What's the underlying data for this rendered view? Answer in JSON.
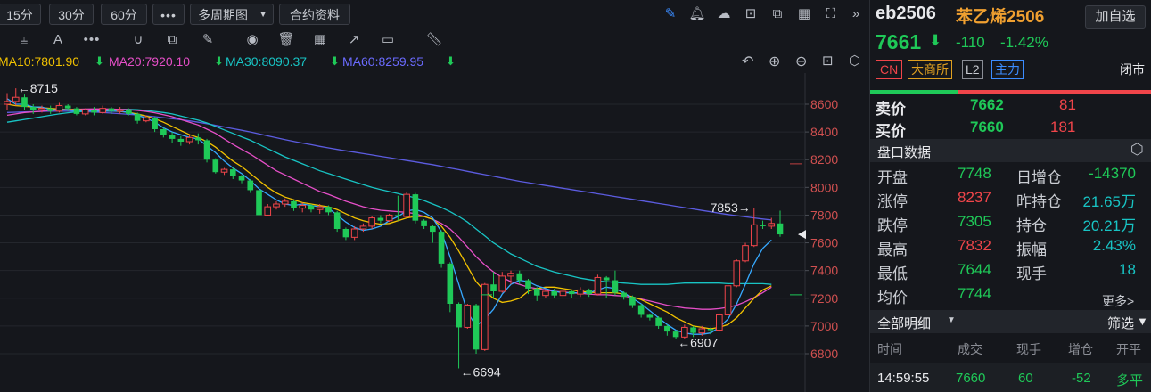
{
  "toolbar": {
    "periods": [
      "15分",
      "30分",
      "60分"
    ],
    "more": "•••",
    "multi_period": "多周期图",
    "contract_info": "合约资料"
  },
  "ma_legend": {
    "ma10": "MA10:7801.90",
    "ma20": "MA20:7920.10",
    "ma30": "MA30:8090.37",
    "ma60": "MA60:8259.95"
  },
  "colors": {
    "ma5": "#36a9ff",
    "ma10": "#f2c200",
    "ma20": "#e64fc8",
    "ma30": "#18c4c4",
    "ma60": "#5c5ce0",
    "up": "#f0454a",
    "down": "#1fc958"
  },
  "chart_data": {
    "type": "candlestick",
    "ylim": [
      6700,
      8750
    ],
    "yticks": [
      "8600",
      "8400",
      "8200",
      "8000",
      "7800",
      "7600",
      "7400",
      "7200",
      "7000",
      "6800"
    ],
    "ytick_values": [
      8600,
      8400,
      8200,
      8000,
      7800,
      7600,
      7400,
      7200,
      7000,
      6800
    ],
    "annotations": {
      "high": "←8715",
      "low": "←6694",
      "local_low": "←6907",
      "local_high": "7853→"
    },
    "annotation_values": {
      "high": 8715,
      "low": 6694,
      "local_low": 6907,
      "local_high": 7853
    },
    "candles": [
      [
        8600,
        8620,
        8560,
        8680
      ],
      [
        8620,
        8650,
        8590,
        8715
      ],
      [
        8650,
        8580,
        8560,
        8670
      ],
      [
        8580,
        8560,
        8530,
        8600
      ],
      [
        8560,
        8570,
        8540,
        8590
      ],
      [
        8570,
        8550,
        8530,
        8590
      ],
      [
        8550,
        8590,
        8540,
        8610
      ],
      [
        8590,
        8570,
        8550,
        8600
      ],
      [
        8570,
        8530,
        8520,
        8580
      ],
      [
        8530,
        8560,
        8520,
        8570
      ],
      [
        8560,
        8540,
        8520,
        8580
      ],
      [
        8540,
        8570,
        8530,
        8590
      ],
      [
        8570,
        8550,
        8530,
        8580
      ],
      [
        8550,
        8560,
        8530,
        8580
      ],
      [
        8560,
        8530,
        8520,
        8570
      ],
      [
        8530,
        8480,
        8460,
        8540
      ],
      [
        8480,
        8500,
        8470,
        8520
      ],
      [
        8500,
        8420,
        8400,
        8510
      ],
      [
        8420,
        8380,
        8360,
        8430
      ],
      [
        8380,
        8350,
        8320,
        8400
      ],
      [
        8350,
        8330,
        8300,
        8370
      ],
      [
        8330,
        8360,
        8310,
        8380
      ],
      [
        8360,
        8340,
        8310,
        8390
      ],
      [
        8340,
        8200,
        8180,
        8350
      ],
      [
        8200,
        8110,
        8100,
        8210
      ],
      [
        8110,
        8130,
        8090,
        8140
      ],
      [
        8130,
        8080,
        8060,
        8150
      ],
      [
        8080,
        8050,
        8030,
        8090
      ],
      [
        8050,
        7980,
        7960,
        8060
      ],
      [
        7980,
        7800,
        7780,
        7990
      ],
      [
        7800,
        7860,
        7790,
        7880
      ],
      [
        7860,
        7880,
        7840,
        7900
      ],
      [
        7880,
        7900,
        7860,
        7920
      ],
      [
        7900,
        7850,
        7830,
        7910
      ],
      [
        7850,
        7870,
        7820,
        7890
      ],
      [
        7870,
        7840,
        7820,
        7880
      ],
      [
        7840,
        7860,
        7810,
        7880
      ],
      [
        7860,
        7820,
        7800,
        7870
      ],
      [
        7820,
        7700,
        7680,
        7830
      ],
      [
        7700,
        7640,
        7620,
        7710
      ],
      [
        7640,
        7700,
        7620,
        7720
      ],
      [
        7700,
        7720,
        7680,
        7740
      ],
      [
        7720,
        7780,
        7700,
        7790
      ],
      [
        7780,
        7760,
        7740,
        7800
      ],
      [
        7760,
        7800,
        7750,
        7810
      ],
      [
        7800,
        7790,
        7760,
        7940
      ],
      [
        7790,
        7950,
        7780,
        7970
      ],
      [
        7950,
        7760,
        7740,
        7960
      ],
      [
        7760,
        7720,
        7700,
        7770
      ],
      [
        7720,
        7680,
        7600,
        7730
      ],
      [
        7680,
        7450,
        7420,
        7690
      ],
      [
        7450,
        7160,
        7100,
        7460
      ],
      [
        7160,
        6990,
        6694,
        7170
      ],
      [
        6990,
        7150,
        6980,
        7160
      ],
      [
        7150,
        6830,
        6800,
        7160
      ],
      [
        6830,
        7300,
        6820,
        7310
      ],
      [
        7300,
        7250,
        7200,
        7390
      ],
      [
        7250,
        7360,
        7240,
        7390
      ],
      [
        7360,
        7380,
        7300,
        7400
      ],
      [
        7380,
        7330,
        7300,
        7400
      ],
      [
        7330,
        7270,
        7230,
        7340
      ],
      [
        7270,
        7220,
        7180,
        7280
      ],
      [
        7220,
        7250,
        7200,
        7260
      ],
      [
        7250,
        7220,
        7200,
        7270
      ],
      [
        7220,
        7250,
        7200,
        7260
      ],
      [
        7250,
        7230,
        7200,
        7260
      ],
      [
        7230,
        7260,
        7210,
        7280
      ],
      [
        7260,
        7230,
        7210,
        7270
      ],
      [
        7230,
        7350,
        7220,
        7370
      ],
      [
        7350,
        7330,
        7200,
        7360
      ],
      [
        7330,
        7240,
        7220,
        7400
      ],
      [
        7240,
        7210,
        7190,
        7250
      ],
      [
        7210,
        7150,
        7130,
        7220
      ],
      [
        7150,
        7080,
        7060,
        7160
      ],
      [
        7080,
        7060,
        7040,
        7090
      ],
      [
        7060,
        7000,
        6980,
        7070
      ],
      [
        7000,
        6960,
        6930,
        7010
      ],
      [
        6960,
        6920,
        6907,
        6970
      ],
      [
        6920,
        6990,
        6910,
        7010
      ],
      [
        6990,
        6950,
        6920,
        7000
      ],
      [
        6950,
        6980,
        6930,
        7000
      ],
      [
        6980,
        6970,
        6940,
        6990
      ],
      [
        6970,
        7080,
        6960,
        7090
      ],
      [
        7080,
        7290,
        7070,
        7300
      ],
      [
        7290,
        7470,
        7280,
        7480
      ],
      [
        7470,
        7580,
        7460,
        7600
      ],
      [
        7580,
        7730,
        7570,
        7853
      ],
      [
        7730,
        7720,
        7700,
        7760
      ],
      [
        7720,
        7740,
        7700,
        7780
      ],
      [
        7740,
        7661,
        7644,
        7832
      ]
    ],
    "ma5": [
      8640,
      8600,
      8600,
      8580,
      8580,
      8560,
      8560,
      8560,
      8550,
      8560,
      8550,
      8550,
      8550,
      8550,
      8540,
      8520,
      8500,
      8470,
      8430,
      8400,
      8380,
      8360,
      8350,
      8300,
      8250,
      8190,
      8140,
      8100,
      8050,
      7990,
      7950,
      7910,
      7880,
      7870,
      7880,
      7870,
      7860,
      7850,
      7800,
      7750,
      7710,
      7690,
      7700,
      7720,
      7760,
      7790,
      7830,
      7840,
      7820,
      7780,
      7680,
      7500,
      7300,
      7100,
      7000,
      7050,
      7120,
      7230,
      7300,
      7330,
      7320,
      7290,
      7270,
      7250,
      7240,
      7240,
      7240,
      7240,
      7260,
      7280,
      7270,
      7240,
      7200,
      7160,
      7110,
      7060,
      7010,
      6970,
      6950,
      6940,
      6940,
      6950,
      6990,
      7050,
      7160,
      7300,
      7450,
      7560,
      7620
    ],
    "ma10": [
      8600,
      8590,
      8585,
      8580,
      8575,
      8570,
      8565,
      8560,
      8560,
      8558,
      8555,
      8552,
      8550,
      8548,
      8540,
      8530,
      8515,
      8495,
      8470,
      8440,
      8410,
      8380,
      8360,
      8330,
      8290,
      8240,
      8190,
      8150,
      8100,
      8050,
      8000,
      7960,
      7930,
      7910,
      7890,
      7880,
      7870,
      7860,
      7840,
      7810,
      7780,
      7760,
      7745,
      7735,
      7740,
      7760,
      7780,
      7790,
      7790,
      7770,
      7720,
      7640,
      7540,
      7430,
      7320,
      7250,
      7200,
      7170,
      7180,
      7200,
      7250,
      7270,
      7280,
      7280,
      7270,
      7260,
      7250,
      7245,
      7240,
      7240,
      7240,
      7230,
      7210,
      7190,
      7160,
      7130,
      7100,
      7060,
      7030,
      7000,
      6990,
      6980,
      6990,
      7010,
      7060,
      7130,
      7200,
      7260,
      7290
    ],
    "ma20": [
      8520,
      8530,
      8540,
      8545,
      8550,
      8555,
      8560,
      8562,
      8564,
      8565,
      8566,
      8566,
      8565,
      8563,
      8560,
      8555,
      8548,
      8538,
      8525,
      8510,
      8490,
      8470,
      8450,
      8420,
      8390,
      8350,
      8310,
      8275,
      8240,
      8200,
      8160,
      8120,
      8090,
      8060,
      8030,
      8000,
      7970,
      7950,
      7925,
      7900,
      7880,
      7860,
      7845,
      7835,
      7830,
      7825,
      7820,
      7810,
      7790,
      7770,
      7740,
      7700,
      7640,
      7570,
      7500,
      7440,
      7390,
      7350,
      7320,
      7300,
      7280,
      7270,
      7260,
      7250,
      7245,
      7240,
      7235,
      7230,
      7225,
      7225,
      7220,
      7215,
      7205,
      7195,
      7180,
      7165,
      7150,
      7140,
      7130,
      7125,
      7120,
      7120,
      7125,
      7135,
      7150,
      7175,
      7205,
      7240,
      7280
    ],
    "ma30": [
      8470,
      8480,
      8490,
      8500,
      8510,
      8520,
      8530,
      8538,
      8545,
      8550,
      8555,
      8560,
      8562,
      8563,
      8563,
      8560,
      8555,
      8548,
      8540,
      8530,
      8515,
      8500,
      8485,
      8465,
      8440,
      8415,
      8390,
      8365,
      8340,
      8310,
      8280,
      8250,
      8220,
      8195,
      8170,
      8145,
      8120,
      8100,
      8080,
      8060,
      8040,
      8020,
      8000,
      7985,
      7970,
      7955,
      7940,
      7925,
      7905,
      7880,
      7855,
      7825,
      7790,
      7750,
      7700,
      7650,
      7600,
      7560,
      7520,
      7490,
      7460,
      7430,
      7410,
      7390,
      7375,
      7360,
      7345,
      7335,
      7325,
      7320,
      7315,
      7310,
      7305,
      7300,
      7300,
      7300,
      7300,
      7305,
      7310,
      7310,
      7310,
      7310,
      7310,
      7305,
      7305,
      7305,
      7305,
      7305,
      7300
    ],
    "ma60": [
      8540,
      8542,
      8544,
      8546,
      8548,
      8550,
      8550,
      8550,
      8548,
      8546,
      8543,
      8540,
      8536,
      8532,
      8527,
      8522,
      8516,
      8510,
      8503,
      8496,
      8488,
      8480,
      8470,
      8460,
      8448,
      8436,
      8424,
      8412,
      8400,
      8386,
      8372,
      8358,
      8345,
      8332,
      8320,
      8308,
      8296,
      8285,
      8274,
      8264,
      8254,
      8244,
      8234,
      8224,
      8214,
      8204,
      8194,
      8184,
      8174,
      8164,
      8152,
      8140,
      8128,
      8116,
      8104,
      8092,
      8080,
      8068,
      8056,
      8044,
      8034,
      8024,
      8014,
      8004,
      7994,
      7984,
      7974,
      7964,
      7954,
      7944,
      7934,
      7924,
      7914,
      7904,
      7894,
      7884,
      7874,
      7864,
      7854,
      7844,
      7834,
      7824,
      7814,
      7804,
      7796,
      7788,
      7780,
      7772,
      7765
    ]
  },
  "quote": {
    "code": "eb2506",
    "name": "苯乙烯2506",
    "add_button": "加自选",
    "last": "7661",
    "arrow": "⬇",
    "change": "-110",
    "change_pct": "-1.42%",
    "tags": [
      "CN",
      "大商所",
      "L2",
      "主力"
    ],
    "session": "闭市"
  },
  "book": {
    "ask_label": "卖价",
    "ask_price": "7662",
    "ask_vol": "81",
    "bid_label": "买价",
    "bid_price": "7660",
    "bid_vol": "181"
  },
  "panel": {
    "title": "盘口数据",
    "rows": [
      {
        "l1": "开盘",
        "v1": "7748",
        "l2": "日增仓",
        "v2": "-14370"
      },
      {
        "l1": "涨停",
        "v1": "8237",
        "l2": "昨持仓",
        "v2": "21.65万"
      },
      {
        "l1": "跌停",
        "v1": "7305",
        "l2": "持仓",
        "v2": "20.21万"
      },
      {
        "l1": "最高",
        "v1": "7832",
        "l2": "振幅",
        "v2": "2.43%"
      },
      {
        "l1": "最低",
        "v1": "7644",
        "l2": "现手",
        "v2": "18"
      },
      {
        "l1": "均价",
        "v1": "7744",
        "l2": "",
        "v2": ""
      }
    ],
    "more": "更多>"
  },
  "detail": {
    "title": "全部明细",
    "filter": "筛选",
    "headers": [
      "时间",
      "成交",
      "现手",
      "增仓",
      "开平"
    ],
    "rows": [
      {
        "time": "14:59:55",
        "price": "7660",
        "vol": "60",
        "oi": "-52",
        "type": "多平"
      }
    ]
  }
}
